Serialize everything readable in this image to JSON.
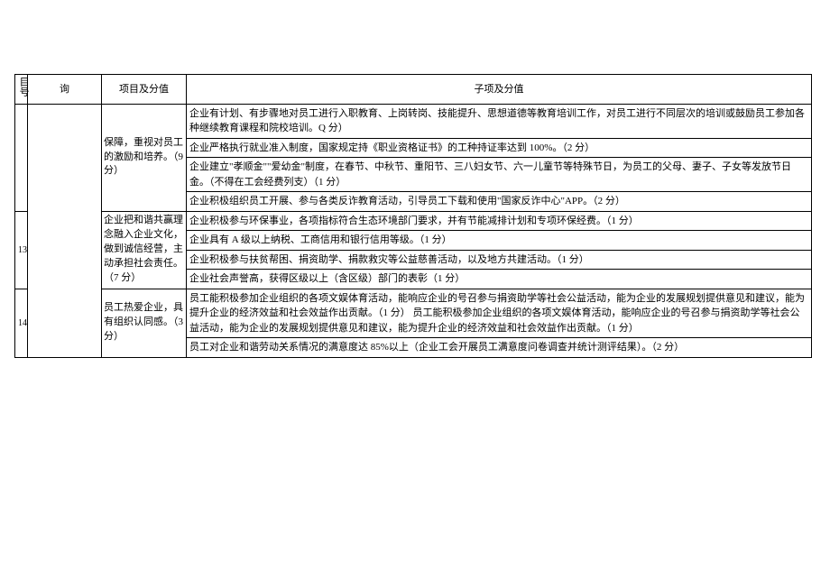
{
  "headers": {
    "seq": "目号",
    "category": "询",
    "project": "项目及分值",
    "sub": "子项及分值"
  },
  "rows": [
    {
      "seqRowspan": 4,
      "catRowspan": 10,
      "projRowspan": 4,
      "proj": "保障，重视对员工的激励和培养。（9 分）",
      "sub": "企业有计划、有步骤地对员工进行入职教育、上岗转岗、技能提升、思想道德等教育培训工作，对员工进行不同层次的培训或鼓励员工参加各种继续教育课程和院校培训。Q 分）"
    },
    {
      "sub": "企业严格执行就业准入制度，国家规定持《职业资格证书》的工种持证率达到 100%。（2 分）"
    },
    {
      "sub": "企业建立\"孝顺金\"\"爱幼金\"制度，在春节、中秋节、重阳节、三八妇女节、六一儿童节等特殊节日，为员工的父母、妻子、子女等发放节日金。（不得在工会经费列支）（1 分）"
    },
    {
      "sub": "企业积极组织员工开展、参与各类反诈教育活动，引导员工下载和使用\"国家反诈中心\"APP。（2 分）"
    },
    {
      "seq": "13",
      "seqRowspan": 4,
      "projRowspan": 4,
      "proj": "企业把和谐共赢理念融入企业文化，做到诚信经营，主动承担社会责任。（7 分）",
      "sub": "企业积极参与环保事业，各项指标符合生态环境部门要求，并有节能减排计划和专项环保经费。（1 分）"
    },
    {
      "sub": "企业具有 A 级以上纳税、工商信用和银行信用等级。（1 分）"
    },
    {
      "sub": "企业积极参与扶贫帮困、捐资助学、捐款救灾等公益慈善活动，以及地方共建活动。（1 分）"
    },
    {
      "sub": "企业社会声誉高，获得区级以上（含区级）部门的表彰（1 分）"
    },
    {
      "seq": "14",
      "seqRowspan": 2,
      "projRowspan": 2,
      "proj": "员工热爱企业，具有组织认同感。（3 分）",
      "sub": "员工能积极参加企业组织的各项文娱体育活动，能响应企业的号召参与捐资助学等社会公益活动，能为企业的发展规划提供意见和建议，能为提升企业的经济效益和社会效益作出贡献。（1 分）\n员工能积极参加企业组织的各项文娱体育活动，能响应企业的号召参与捐资助学等社会公益活动，能为企业的发展规划提供意见和建议，能为提升企业的经济效益和社会效益作出贡献。（1 分）"
    },
    {
      "sub": "员工对企业和谐劳动关系情况的满意度达 85%以上（企业工会开展员工满意度问卷调查并统计测评结果）。（2 分）"
    }
  ]
}
